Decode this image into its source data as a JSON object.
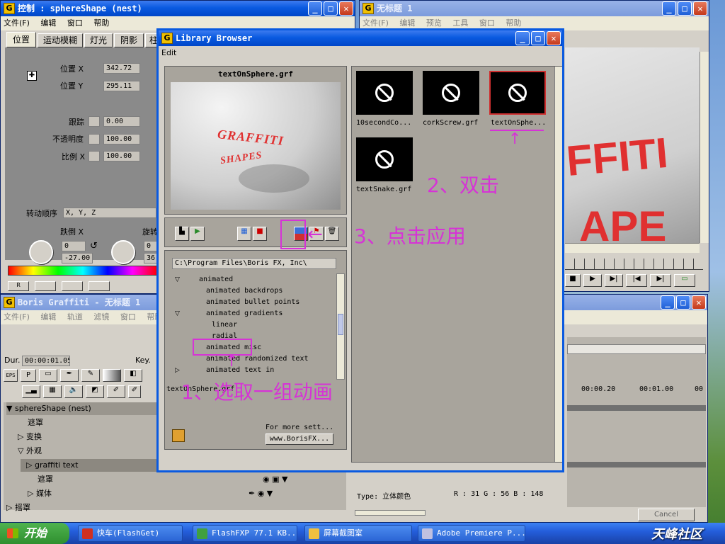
{
  "control_window": {
    "title": "控制 : sphereShape (nest)",
    "menu": [
      "文件(F)",
      "编辑",
      "窗口",
      "帮助"
    ],
    "tabs": [
      "位置",
      "运动模糊",
      "灯光",
      "阴影",
      "柱"
    ],
    "pos_x_label": "位置 X",
    "pos_x_value": "342.72",
    "pos_y_label": "位置 Y",
    "pos_y_value": "295.11",
    "track_label": "跟踪",
    "track_value": "0.00",
    "opacity_label": "不透明度",
    "opacity_value": "100.00",
    "scale_label": "比例 X",
    "scale_value": "100.00",
    "rot_order_label": "转动顺序",
    "rot_order_value": "X, Y, Z",
    "tilt_label": "跌倒 X",
    "rot_label": "旋转",
    "tilt_value": "0",
    "tilt_value2": "-27.00",
    "rot_value": "0",
    "rot_value2": "36"
  },
  "untitled_window": {
    "title": "无标题 1",
    "menu": [
      "文件(F)",
      "编辑",
      "预览",
      "工具",
      "窗口",
      "帮助"
    ],
    "preview_text": "FFITI",
    "preview_text2": "APE"
  },
  "library": {
    "title": "Library Browser",
    "menu": [
      "Edit"
    ],
    "preview_filename": "textOnSphere.grf",
    "graffiti_line1": "GRAFFITI",
    "graffiti_line2": "SHAPES",
    "path": "C:\\Program Files\\Boris FX, Inc\\",
    "tree": [
      {
        "label": "animated",
        "expanded": true
      },
      {
        "label": "animated backdrops"
      },
      {
        "label": "animated bullet points"
      },
      {
        "label": "animated gradients",
        "expanded": true
      },
      {
        "label": "linear"
      },
      {
        "label": "radial"
      },
      {
        "label": "animated misc"
      },
      {
        "label": "animated randomized text"
      },
      {
        "label": "animated text in",
        "collapsed": true
      }
    ],
    "status_file": "textOnSphere.grf",
    "more_text": "For more sett...",
    "more_link": "www.BorisFX...",
    "thumbnails": [
      {
        "label": "10secondCo..."
      },
      {
        "label": "corkScrew.grf"
      },
      {
        "label": "textOnSphe..."
      },
      {
        "label": "textSnake.grf"
      }
    ]
  },
  "graffiti_window": {
    "title": "Boris Graffiti - 无标题 1",
    "menu": [
      "文件(F)",
      "编辑",
      "轨道",
      "滤镜",
      "窗口",
      "帮助"
    ],
    "dur_label": "Dur.",
    "dur_value": "00:00:01.05",
    "key_label": "Key.",
    "eps_label": "EPS",
    "p_label": "P",
    "layers": [
      "sphereShape (nest)",
      "遮罩",
      "变换",
      "外观",
      "graffiti text",
      "遮罩",
      "媒体",
      "摇罩"
    ],
    "timecodes": [
      "00:00.20",
      "00:01.00",
      "00"
    ],
    "type_label": "Type: 立体颜色",
    "rgb_text": "R : 31   G : 56   B : 148",
    "cancel_label": "Cancel"
  },
  "annotations": {
    "step1": "1、选取一组动画",
    "step2": "2、双击",
    "step3": "3、点击应用"
  },
  "taskbar": {
    "start": "开始",
    "tasks": [
      "快车(FlashGet)",
      "FlashFXP 77.1 KB...",
      "屏幕截图室",
      "Adobe Premiere P..."
    ],
    "watermark": "天峰社区"
  },
  "colors": {
    "annotation": "#d633d6",
    "titlebar": "#0a5ae0",
    "graffiti_red": "#e03030"
  }
}
